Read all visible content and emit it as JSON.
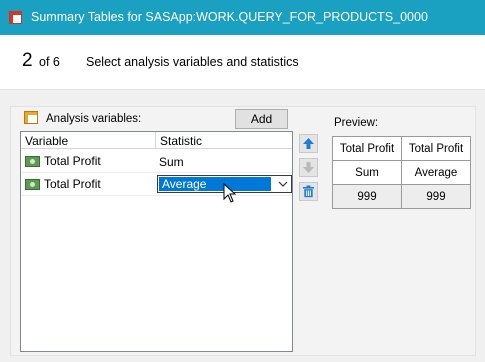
{
  "window": {
    "title": "Summary Tables for SASApp:WORK.QUERY_FOR_PRODUCTS_0000",
    "title_color": "#1aa0c1"
  },
  "wizard": {
    "step": "2",
    "of_total": "of 6",
    "description": "Select analysis variables and statistics"
  },
  "analysis": {
    "label": "Analysis variables:",
    "add_label": "Add",
    "columns": {
      "variable": "Variable",
      "statistic": "Statistic"
    },
    "rows": [
      {
        "variable": "Total Profit",
        "statistic": "Sum"
      },
      {
        "variable": "Total Profit",
        "statistic": "Average"
      }
    ],
    "selected_color": "#0078d7"
  },
  "side_buttons": {
    "icons": [
      "arrow-up-icon",
      "arrow-down-icon",
      "trash-icon"
    ]
  },
  "preview": {
    "label": "Preview:",
    "headers": [
      "Total Profit",
      "Total Profit"
    ],
    "stats": [
      "Sum",
      "Average"
    ],
    "values": [
      "999",
      "999"
    ]
  }
}
